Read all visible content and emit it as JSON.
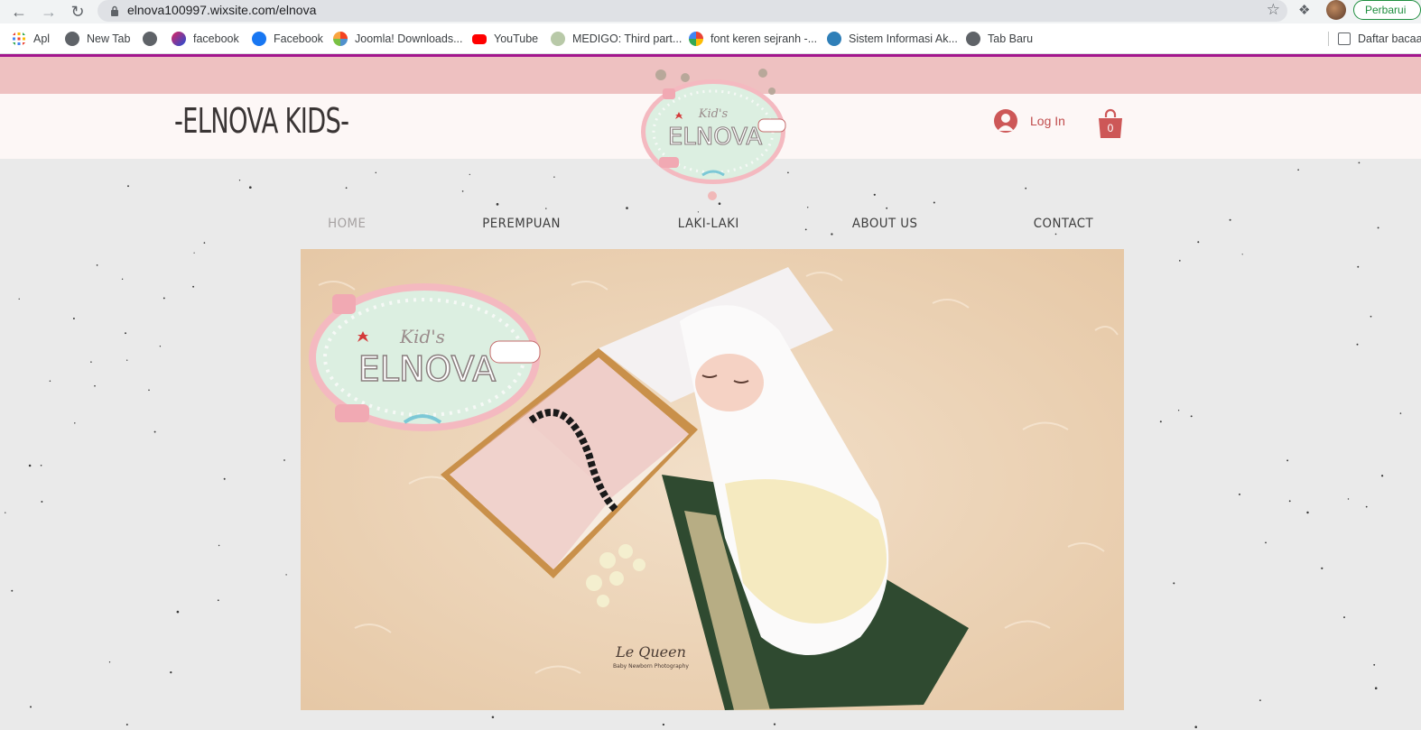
{
  "browser": {
    "url": "elnova100997.wixsite.com/elnova",
    "update_label": "Perbarui",
    "bookmarks": [
      {
        "label": "Apl",
        "icon": "apps-grid-icon"
      },
      {
        "label": "New Tab",
        "icon": "globe-icon"
      },
      {
        "label": "facebook",
        "icon": "d-logo-icon"
      },
      {
        "label": "Facebook",
        "icon": "facebook-icon"
      },
      {
        "label": "Joomla! Downloads...",
        "icon": "joomla-icon"
      },
      {
        "label": "YouTube",
        "icon": "youtube-icon"
      },
      {
        "label": "MEDIGO: Third part...",
        "icon": "medigo-icon"
      },
      {
        "label": "font keren sejranh -...",
        "icon": "google-icon"
      },
      {
        "label": "Sistem Informasi Ak...",
        "icon": "university-icon"
      },
      {
        "label": "Tab Baru",
        "icon": "globe-icon"
      }
    ],
    "reading_list_label": "Daftar bacaan"
  },
  "site": {
    "title": "-ELNOVA KIDS-",
    "logo_text_top": "Kid's",
    "logo_text_main": "ELNOVA",
    "login_label": "Log In",
    "cart_count": "0",
    "menu": [
      {
        "label": "HOME",
        "active": true
      },
      {
        "label": "PEREMPUAN",
        "active": false
      },
      {
        "label": "LAKI-LAKI",
        "active": false
      },
      {
        "label": "ABOUT US",
        "active": false
      },
      {
        "label": "CONTACT",
        "active": false
      }
    ],
    "hero": {
      "logo_text_top": "Kid's",
      "logo_text_main": "ELNOVA",
      "watermark": "Le Queen",
      "watermark_sub": "Baby Newborn Photography"
    }
  },
  "colors": {
    "accent_line": "#a3168d",
    "pink_strip": "#eec1c1",
    "brand_red": "#c04d4d"
  }
}
